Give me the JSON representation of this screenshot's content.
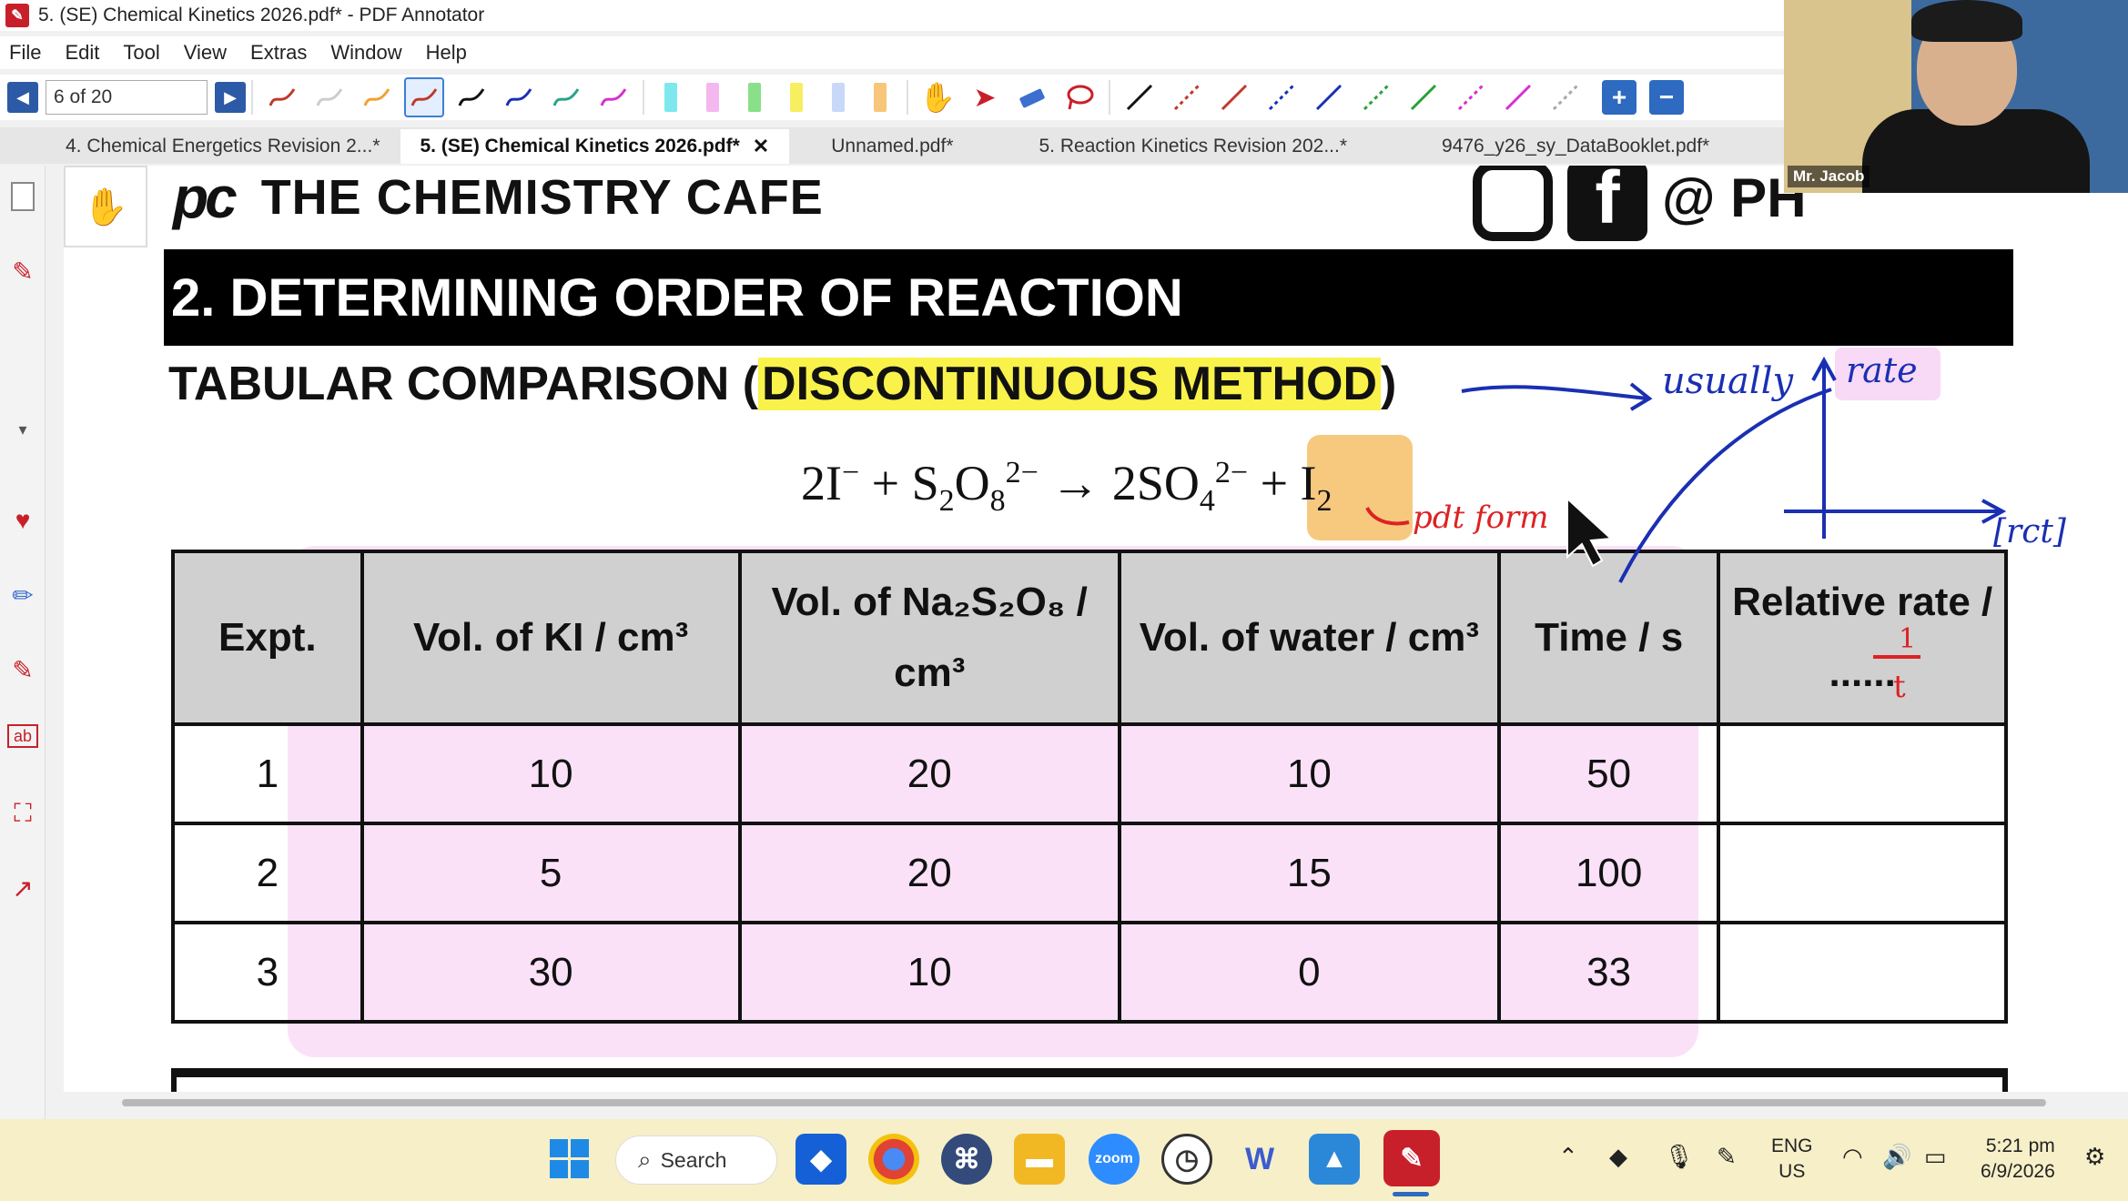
{
  "window": {
    "title": "5. (SE) Chemical Kinetics 2026.pdf* - PDF Annotator",
    "app_icon": "pdf-annotator-icon"
  },
  "menu": [
    "File",
    "Edit",
    "Tool",
    "View",
    "Extras",
    "Window",
    "Help"
  ],
  "toolbar": {
    "page_value": "6 of 20",
    "pen_colors": [
      "#c0392b",
      "#cccccc",
      "#f0a030",
      "#c0392b",
      "#111111",
      "#1a2fb3",
      "#2aa38a",
      "#d62fd1"
    ],
    "highlighter_colors": [
      "#7fe8ee",
      "#f3b8f0",
      "#88e088",
      "#f7ee60",
      "#c8d8f8",
      "#f7c67a"
    ],
    "line_colors": [
      "#111111",
      "#c0392b",
      "#c0392b",
      "#1a2fb3",
      "#1a2fb3",
      "#2aa038",
      "#2aa038",
      "#d62fd1",
      "#d62fd1",
      "#aaaaaa"
    ]
  },
  "tabs": [
    {
      "label": "4. Chemical Energetics Revision 2...*",
      "active": false
    },
    {
      "label": "5. (SE) Chemical Kinetics 2026.pdf*",
      "active": true,
      "close": "✕"
    },
    {
      "label": "Unnamed.pdf*",
      "active": false
    },
    {
      "label": "5. Reaction Kinetics Revision 202...*",
      "active": false
    },
    {
      "label": "9476_y26_sy_DataBooklet.pdf*",
      "active": false
    }
  ],
  "document": {
    "brand_logo": "pc",
    "brand_name": "THE CHEMISTRY CAFE",
    "social_handle": "@ PH",
    "banner": "2. DETERMINING ORDER OF REACTION",
    "subheading_pre": "TABULAR COMPARISON (",
    "subheading_highlight": "DISCONTINUOUS METHOD",
    "subheading_post": ")",
    "equation": {
      "part1": "2I",
      "part1_sup": "−",
      "part2": " + S",
      "part2_sub1": "2",
      "part2_mid": "O",
      "part2_sub2": "8",
      "part2_sup": "2−",
      "arrow": " → 2SO",
      "part3_sub": "4",
      "part3_sup": "2−",
      "part4": " + I",
      "part4_sub": "2"
    },
    "table": {
      "headers": [
        "Expt.",
        "Vol. of KI / cm³",
        "Vol. of Na₂S₂O₈ / cm³",
        "Vol. of water / cm³",
        "Time / s",
        "Relative rate / ......"
      ],
      "rows": [
        [
          "1",
          "10",
          "20",
          "10",
          "50",
          ""
        ],
        [
          "2",
          "5",
          "20",
          "15",
          "100",
          ""
        ],
        [
          "3",
          "30",
          "10",
          "0",
          "33",
          ""
        ]
      ]
    },
    "annotations": {
      "usually": "usually",
      "rate": "rate",
      "pdt_form": "pdt form",
      "rct": "[rct]",
      "one_over_t_num": "1",
      "one_over_t_den": "t"
    }
  },
  "webcam": {
    "name": "Mr. Jacob"
  },
  "taskbar": {
    "search_label": "Search",
    "lang_top": "ENG",
    "lang_bottom": "US",
    "time": "5:21 pm",
    "date": "6/9/2026"
  }
}
